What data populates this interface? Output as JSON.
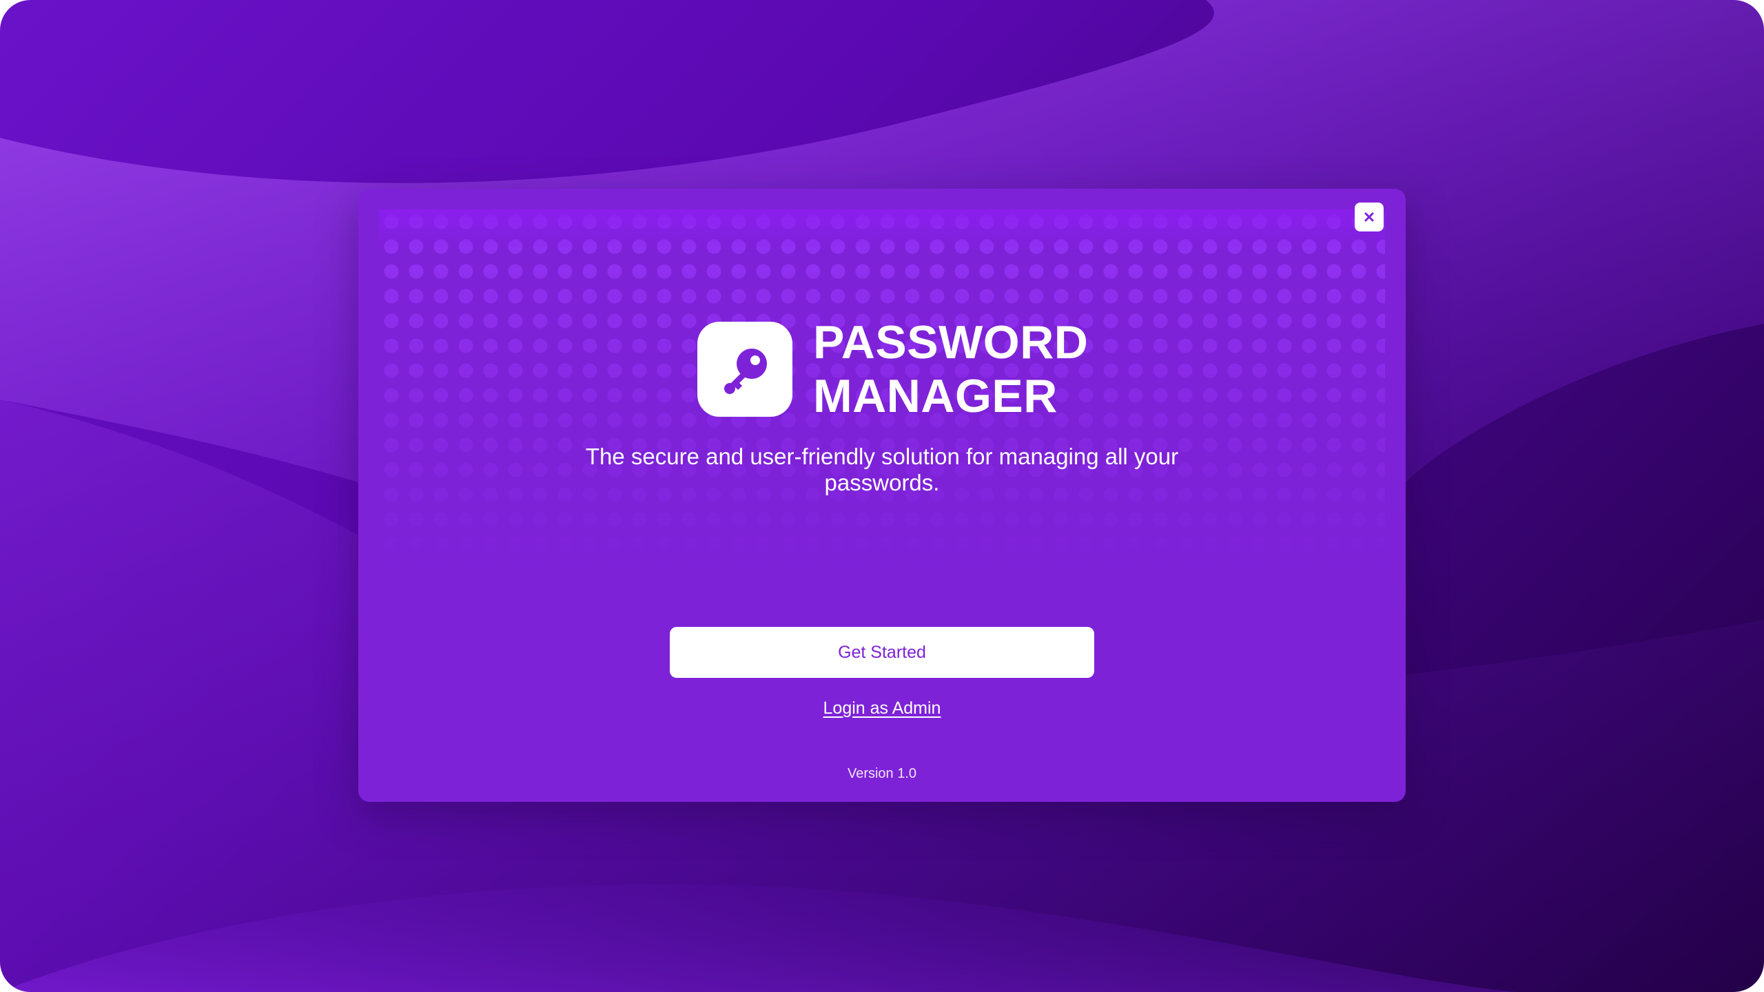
{
  "app": {
    "title_line1": "PASSWORD",
    "title_line2": "MANAGER",
    "tagline": "The secure and user-friendly solution for managing all your passwords.",
    "icon": "key-icon"
  },
  "actions": {
    "close_icon": "close-icon",
    "primary_label": "Get Started",
    "admin_link_label": "Login as Admin"
  },
  "footer": {
    "version": "Version 1.0"
  },
  "colors": {
    "dialog_background": "#7e22d8",
    "accent": "#7e22d8",
    "button_background": "#ffffff",
    "text": "#ffffff"
  }
}
